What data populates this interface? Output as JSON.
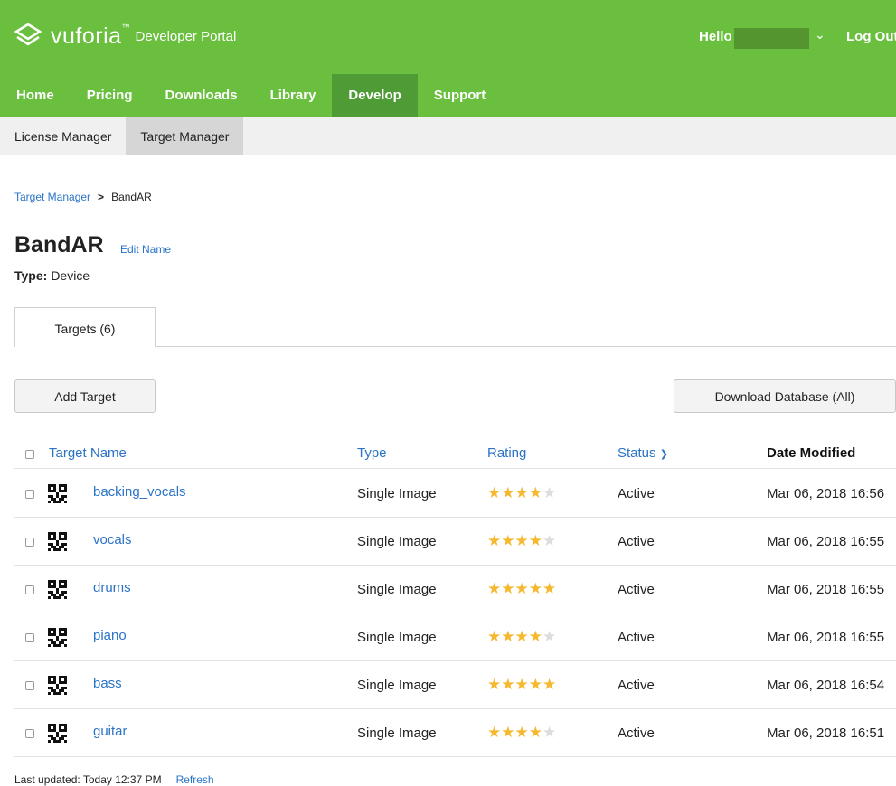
{
  "header": {
    "brand": "vuforia",
    "trademark": "™",
    "portal": "Developer Portal",
    "greeting": "Hello",
    "logout": "Log Out",
    "accent": "#6abf3f"
  },
  "nav": {
    "items": [
      {
        "label": "Home"
      },
      {
        "label": "Pricing"
      },
      {
        "label": "Downloads"
      },
      {
        "label": "Library"
      },
      {
        "label": "Develop"
      },
      {
        "label": "Support"
      }
    ],
    "active": "Develop"
  },
  "subnav": {
    "items": [
      {
        "label": "License Manager"
      },
      {
        "label": "Target Manager"
      }
    ],
    "active": "Target Manager"
  },
  "breadcrumb": {
    "parent": "Target Manager",
    "separator": ">",
    "current": "BandAR"
  },
  "database": {
    "name": "BandAR",
    "edit_label": "Edit Name",
    "type_label": "Type:",
    "type_value": "Device"
  },
  "tabs": [
    {
      "label": "Targets (6)"
    }
  ],
  "actions": {
    "add": "Add Target",
    "download": "Download Database (All)"
  },
  "table": {
    "headers": {
      "name": "Target Name",
      "type": "Type",
      "rating": "Rating",
      "status": "Status",
      "date": "Date Modified"
    },
    "rows": [
      {
        "name": "backing_vocals",
        "type": "Single Image",
        "rating": 4,
        "status": "Active",
        "date": "Mar 06, 2018 16:56"
      },
      {
        "name": "vocals",
        "type": "Single Image",
        "rating": 4,
        "status": "Active",
        "date": "Mar 06, 2018 16:55"
      },
      {
        "name": "drums",
        "type": "Single Image",
        "rating": 5,
        "status": "Active",
        "date": "Mar 06, 2018 16:55"
      },
      {
        "name": "piano",
        "type": "Single Image",
        "rating": 4,
        "status": "Active",
        "date": "Mar 06, 2018 16:55"
      },
      {
        "name": "bass",
        "type": "Single Image",
        "rating": 5,
        "status": "Active",
        "date": "Mar 06, 2018 16:54"
      },
      {
        "name": "guitar",
        "type": "Single Image",
        "rating": 4,
        "status": "Active",
        "date": "Mar 06, 2018 16:51"
      }
    ]
  },
  "footer": {
    "last_updated": "Last updated: Today 12:37 PM",
    "refresh": "Refresh"
  }
}
